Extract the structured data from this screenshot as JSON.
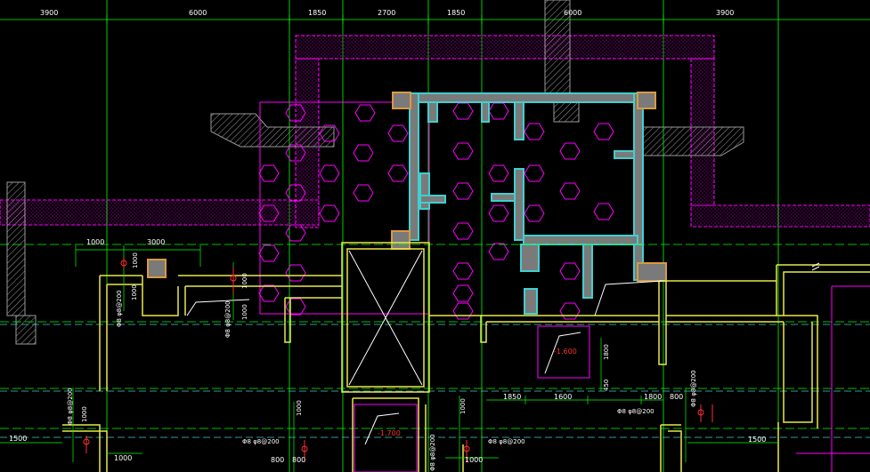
{
  "top_dimensions": [
    "3900",
    "6000",
    "1850",
    "2700",
    "1850",
    "6000",
    "3900"
  ],
  "dimensions": {
    "d1000_a": "1000",
    "d3000": "3000",
    "d1000_b": "1000",
    "d1000_c": "1000",
    "d1000_d": "1000",
    "d1800_right": "1800",
    "d450": "450",
    "d1850_low": "1850",
    "d1600": "1600",
    "d1800_low": "1800",
    "d800_r": "800",
    "d1000_left_low": "1000",
    "d1500_left": "1500",
    "d1000_bottom_left": "1000",
    "d800_bl": "800",
    "d800_bm": "800",
    "d1000_bm": "1000",
    "d1000_mid": "1000",
    "d1500_right": "1500",
    "d1000_far_right": "1000",
    "d1000_center": "1000"
  },
  "rebar_notes": {
    "n1": "Φ8 φ8@200",
    "n2": "Φ8 φ8@200",
    "n3": "Φ8 φ8@200",
    "n4": "Φ8 φ8@200",
    "n5": "Φ8 φ8@200",
    "n6": "Φ8 φ8@200",
    "n7": "Φ8 φ8@200",
    "n8": "Φ8 φ8@200"
  },
  "levels": {
    "pit_level": "-1.600",
    "stair_level": "-1.700"
  },
  "colors": {
    "background": "#000000",
    "axis_green": "#00ff00",
    "wall_yellow": "#e8e84a",
    "wall_cyan": "#3fd0d0",
    "hex_magenta": "#ff00ff",
    "dim_white": "#ffffff",
    "column_orange": "#d99a40",
    "wall_gray": "#8a8a8a"
  }
}
